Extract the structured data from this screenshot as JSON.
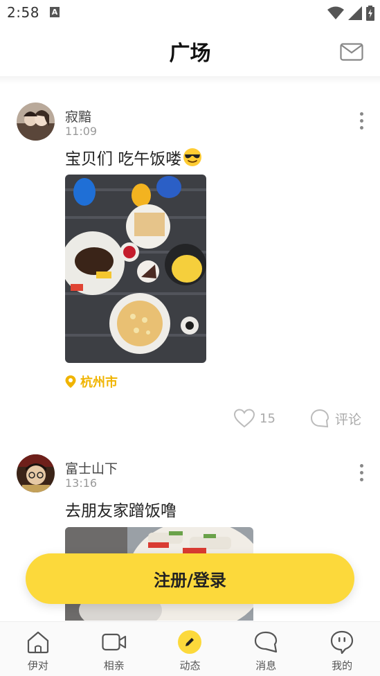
{
  "status_bar": {
    "time": "2:58",
    "notif_letter": "A"
  },
  "header": {
    "title": "广场",
    "mail_icon": "mail-icon"
  },
  "posts": [
    {
      "username": "寂黯",
      "time": "11:09",
      "text": "宝贝们 吃午饭喽",
      "emoji": "sunglasses-emoji",
      "location": "杭州市",
      "likes": "15",
      "comment_label": "评论"
    },
    {
      "username": "富士山下",
      "time": "13:16",
      "text": "去朋友家蹭饭噜"
    }
  ],
  "login_button": {
    "label": "注册/登录"
  },
  "tabs": [
    {
      "label": "伊对",
      "icon": "home-icon"
    },
    {
      "label": "相亲",
      "icon": "video-camera-icon"
    },
    {
      "label": "动态",
      "icon": "pencil-icon"
    },
    {
      "label": "消息",
      "icon": "chat-bubble-icon"
    },
    {
      "label": "我的",
      "icon": "profile-face-icon"
    }
  ],
  "colors": {
    "accent": "#fcd93b",
    "location": "#f0b400"
  }
}
